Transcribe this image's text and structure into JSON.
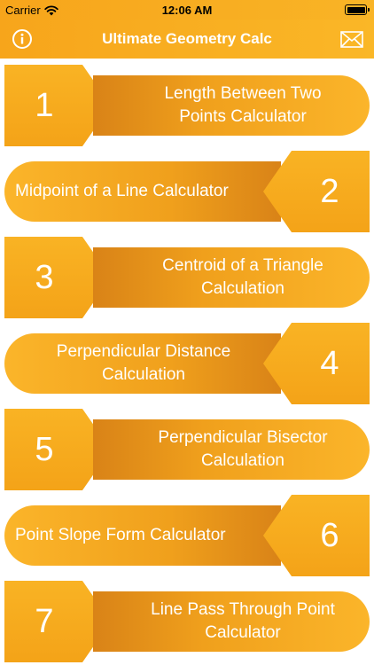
{
  "status": {
    "carrier": "Carrier",
    "time": "12:06 AM"
  },
  "nav": {
    "title": "Ultimate Geometry Calc"
  },
  "items": [
    {
      "number": "1",
      "label": "Length Between Two Points Calculator"
    },
    {
      "number": "2",
      "label": "Midpoint of a Line Calculator"
    },
    {
      "number": "3",
      "label": "Centroid of a Triangle Calculation"
    },
    {
      "number": "4",
      "label": "Perpendicular Distance Calculation"
    },
    {
      "number": "5",
      "label": "Perpendicular Bisector Calculation"
    },
    {
      "number": "6",
      "label": "Point Slope Form Calculator"
    },
    {
      "number": "7",
      "label": "Line Pass Through Point Calculator"
    }
  ]
}
